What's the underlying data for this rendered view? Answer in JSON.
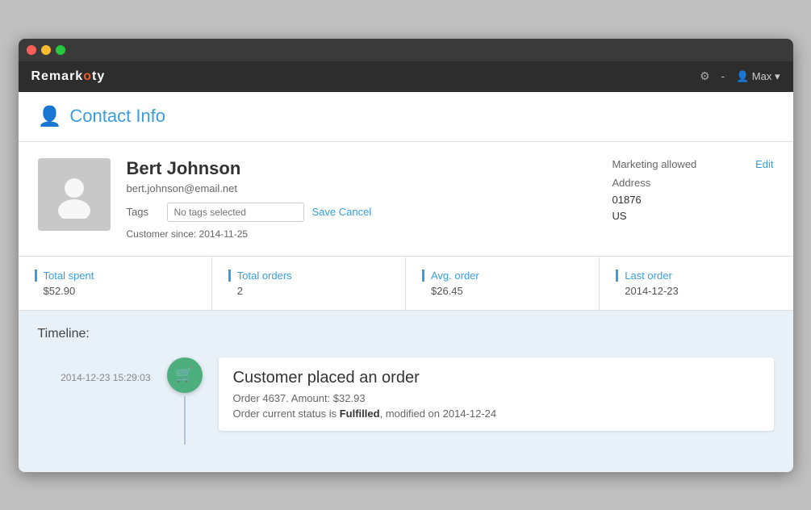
{
  "window": {
    "title": "Remarkety"
  },
  "topbar": {
    "logo_text": "Remarkety",
    "gear_symbol": "⚙",
    "dash_symbol": "-",
    "user_icon": "👤",
    "user_label": "Max",
    "dropdown_arrow": "▾"
  },
  "page": {
    "title": "Contact Info",
    "person_icon": "👤"
  },
  "contact": {
    "name": "Bert Johnson",
    "email": "bert.johnson@email.net",
    "tags_placeholder": "No tags selected",
    "save_cancel_label": "Save Cancel",
    "customer_since_label": "Customer since:",
    "customer_since_value": "2014-11-25",
    "marketing_allowed": "Marketing allowed",
    "edit_label": "Edit",
    "address_label": "Address",
    "address_zip": "01876",
    "address_country": "US"
  },
  "stats": [
    {
      "title": "Total spent",
      "value": "$52.90"
    },
    {
      "title": "Total orders",
      "value": "2"
    },
    {
      "title": "Avg. order",
      "value": "$26.45"
    },
    {
      "title": "Last order",
      "value": "2014-12-23"
    }
  ],
  "timeline": {
    "label": "Timeline:",
    "event_date": "2014-12-23 15:29:03",
    "cart_icon": "🛒",
    "event_title": "Customer placed an order",
    "event_sub": "Order 4637. Amount: $32.93",
    "event_status_pre": "Order current status is ",
    "event_status_highlight": "Fulfilled",
    "event_status_post": ", modified on 2014-12-24"
  }
}
